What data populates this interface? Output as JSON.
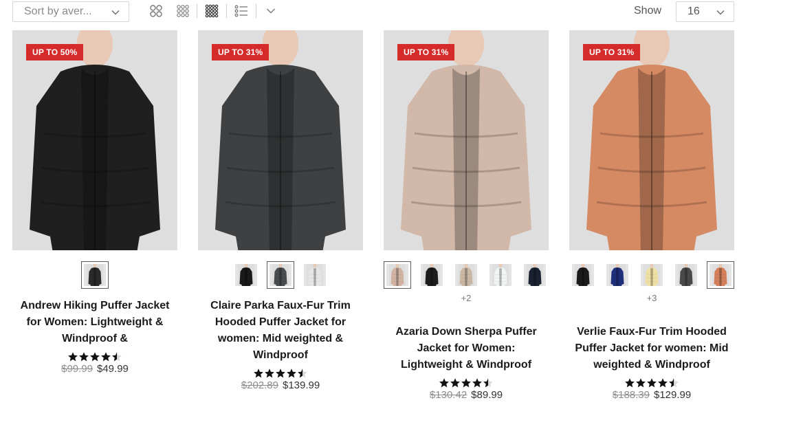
{
  "toolbar": {
    "sort_label": "Sort by aver...",
    "show_label": "Show",
    "show_value": "16",
    "view_icons": [
      "grid-2-icon",
      "grid-3-icon",
      "grid-4-icon",
      "list-view-icon",
      "chevron-down-icon"
    ]
  },
  "products": [
    {
      "badge": "UP TO 50%",
      "title": "Andrew Hiking Puffer Jacket for Women: Lightweight & Windproof &",
      "rating": 4.5,
      "old_price": "$99.99",
      "new_price": "$49.99",
      "more": "",
      "jacket_color": "#1f1f1f",
      "swatches": [
        {
          "color": "#2b2b2b",
          "selected": true
        }
      ]
    },
    {
      "badge": "UP TO 31%",
      "title": "Claire Parka Faux-Fur Trim Hooded Puffer Jacket for women: Mid weighted & Windproof",
      "rating": 4.5,
      "old_price": "$202.89",
      "new_price": "$139.99",
      "more": "",
      "jacket_color": "#3f4042",
      "swatches": [
        {
          "color": "#1a1a1a",
          "selected": false
        },
        {
          "color": "#4a4b4d",
          "selected": true
        },
        {
          "color": "#e6e6e6",
          "selected": false
        }
      ]
    },
    {
      "badge": "UP TO 31%",
      "title": "Azaria Down Sherpa Puffer Jacket for Women: Lightweight & Windproof",
      "rating": 4.5,
      "old_price": "$130.42",
      "new_price": "$89.99",
      "more": "+2",
      "jacket_color": "#d2b8a8",
      "swatches": [
        {
          "color": "#d1b3a3",
          "selected": true
        },
        {
          "color": "#1c1c1c",
          "selected": false
        },
        {
          "color": "#c9b8a4",
          "selected": false
        },
        {
          "color": "#eef5f3",
          "selected": false
        },
        {
          "color": "#1d2233",
          "selected": false
        }
      ]
    },
    {
      "badge": "UP TO 31%",
      "title": "Verlie Faux-Fur Trim Hooded Puffer Jacket for women: Mid weighted & Windproof",
      "rating": 4.5,
      "old_price": "$188.39",
      "new_price": "$129.99",
      "more": "+3",
      "jacket_color": "#d68a63",
      "swatches": [
        {
          "color": "#1b1b1b",
          "selected": false
        },
        {
          "color": "#1f2f7a",
          "selected": false
        },
        {
          "color": "#efe0a6",
          "selected": false
        },
        {
          "color": "#4a4a4a",
          "selected": false
        },
        {
          "color": "#d27f5a",
          "selected": true
        }
      ]
    }
  ]
}
